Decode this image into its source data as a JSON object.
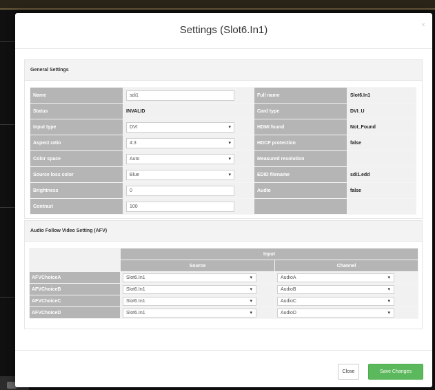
{
  "modal": {
    "title": "Settings (Slot6.In1)",
    "close_glyph": "×"
  },
  "general": {
    "heading": "General Settings",
    "rows_left": [
      {
        "label": "Name",
        "value": "sdi1",
        "control": "input"
      },
      {
        "label": "Status",
        "value": "INVALID",
        "control": "text"
      },
      {
        "label": "Input type",
        "value": "DVI",
        "control": "select"
      },
      {
        "label": "Aspect ratio",
        "value": "4:3",
        "control": "select"
      },
      {
        "label": "Color space",
        "value": "Auto",
        "control": "select"
      },
      {
        "label": "Source loss color",
        "value": "Blue",
        "control": "select"
      },
      {
        "label": "Brightness",
        "value": "0",
        "control": "input"
      },
      {
        "label": "Contrast",
        "value": "100",
        "control": "input"
      }
    ],
    "rows_right": [
      {
        "label": "Full name",
        "value": "Slot6.In1"
      },
      {
        "label": "Card type",
        "value": "DVI_U"
      },
      {
        "label": "HDMI found",
        "value": "Not_Found"
      },
      {
        "label": "HDCP protection",
        "value": "false"
      },
      {
        "label": "Measured resolution",
        "value": ""
      },
      {
        "label": "EDID filename",
        "value": "sdi1.edd"
      },
      {
        "label": "Audio",
        "value": "false"
      }
    ]
  },
  "afv": {
    "heading": "Audio Follow Video Setting (AFV)",
    "input_header": "Input",
    "source_header": "Source",
    "channel_header": "Channel",
    "rows": [
      {
        "label": "AFVChoiceA",
        "source": "Slot6.In1",
        "channel": "AudioA"
      },
      {
        "label": "AFVChoiceB",
        "source": "Slot6.In1",
        "channel": "AudioB"
      },
      {
        "label": "AFVChoiceC",
        "source": "Slot6.In1",
        "channel": "AudioC"
      },
      {
        "label": "AFVChoiceD",
        "source": "Slot6.In1",
        "channel": "AudioD"
      }
    ]
  },
  "footer": {
    "close_label": "Close",
    "save_label": "Save Changes"
  },
  "icons": {
    "select_arrow": "▾"
  },
  "colors": {
    "save_button": "#5cb85c",
    "label_cell": "#b5b5b5",
    "value_cell": "#f1f1f1"
  }
}
